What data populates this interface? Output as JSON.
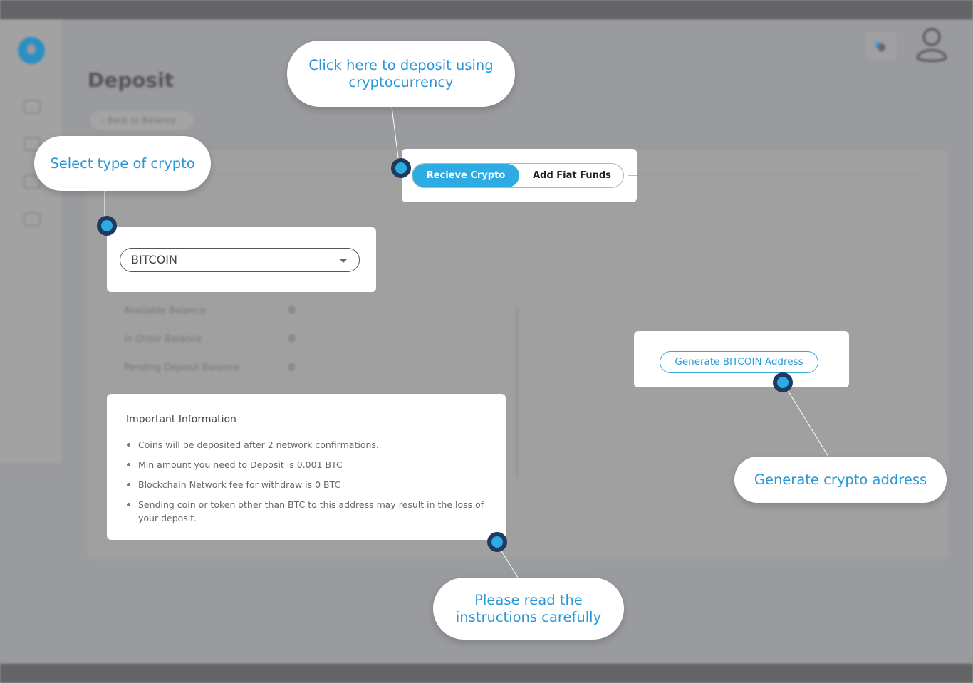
{
  "app": {
    "page_title": "Deposit",
    "back_button": "‹ Back to Balance",
    "sidebar_icons": [
      "wallet-icon",
      "chart-icon",
      "transfer-icon",
      "cart-icon"
    ],
    "header_icons": [
      "notifications-icon",
      "user-avatar-icon"
    ]
  },
  "deposit": {
    "tabs": [
      {
        "label": "Recieve Crypto",
        "active": true
      },
      {
        "label": "Add Fiat Funds",
        "active": false
      }
    ],
    "crypto_select": {
      "value": "BITCOIN"
    },
    "balances": [
      {
        "label": "Available Balance",
        "value": "0"
      },
      {
        "label": "In Order Balance",
        "value": "0"
      },
      {
        "label": "Pending Deposit Balance",
        "value": "0"
      }
    ],
    "info": {
      "title": "Important Information",
      "items": [
        "Coins will be deposited after 2 network confirmations.",
        "Min amount you need to Deposit is 0.001 BTC",
        "Blockchain Network fee for withdraw is 0 BTC",
        "Sending coin or token other than BTC to this address may result in the loss of your deposit."
      ]
    },
    "generate_button": "Generate BITCOIN Address"
  },
  "tour": {
    "callouts": [
      {
        "id": "crypto-tab",
        "text": "Click here to deposit using cryptocurrency"
      },
      {
        "id": "select-crypto",
        "text": "Select type of crypto"
      },
      {
        "id": "generate-address",
        "text": "Generate crypto address"
      },
      {
        "id": "instructions",
        "text": "Please read the instructions carefully"
      }
    ]
  },
  "colors": {
    "accent": "#2dabe3",
    "callout_text": "#2a97d6",
    "dot_ring": "#1e3a5f",
    "overlay": "#9a9b9e"
  }
}
